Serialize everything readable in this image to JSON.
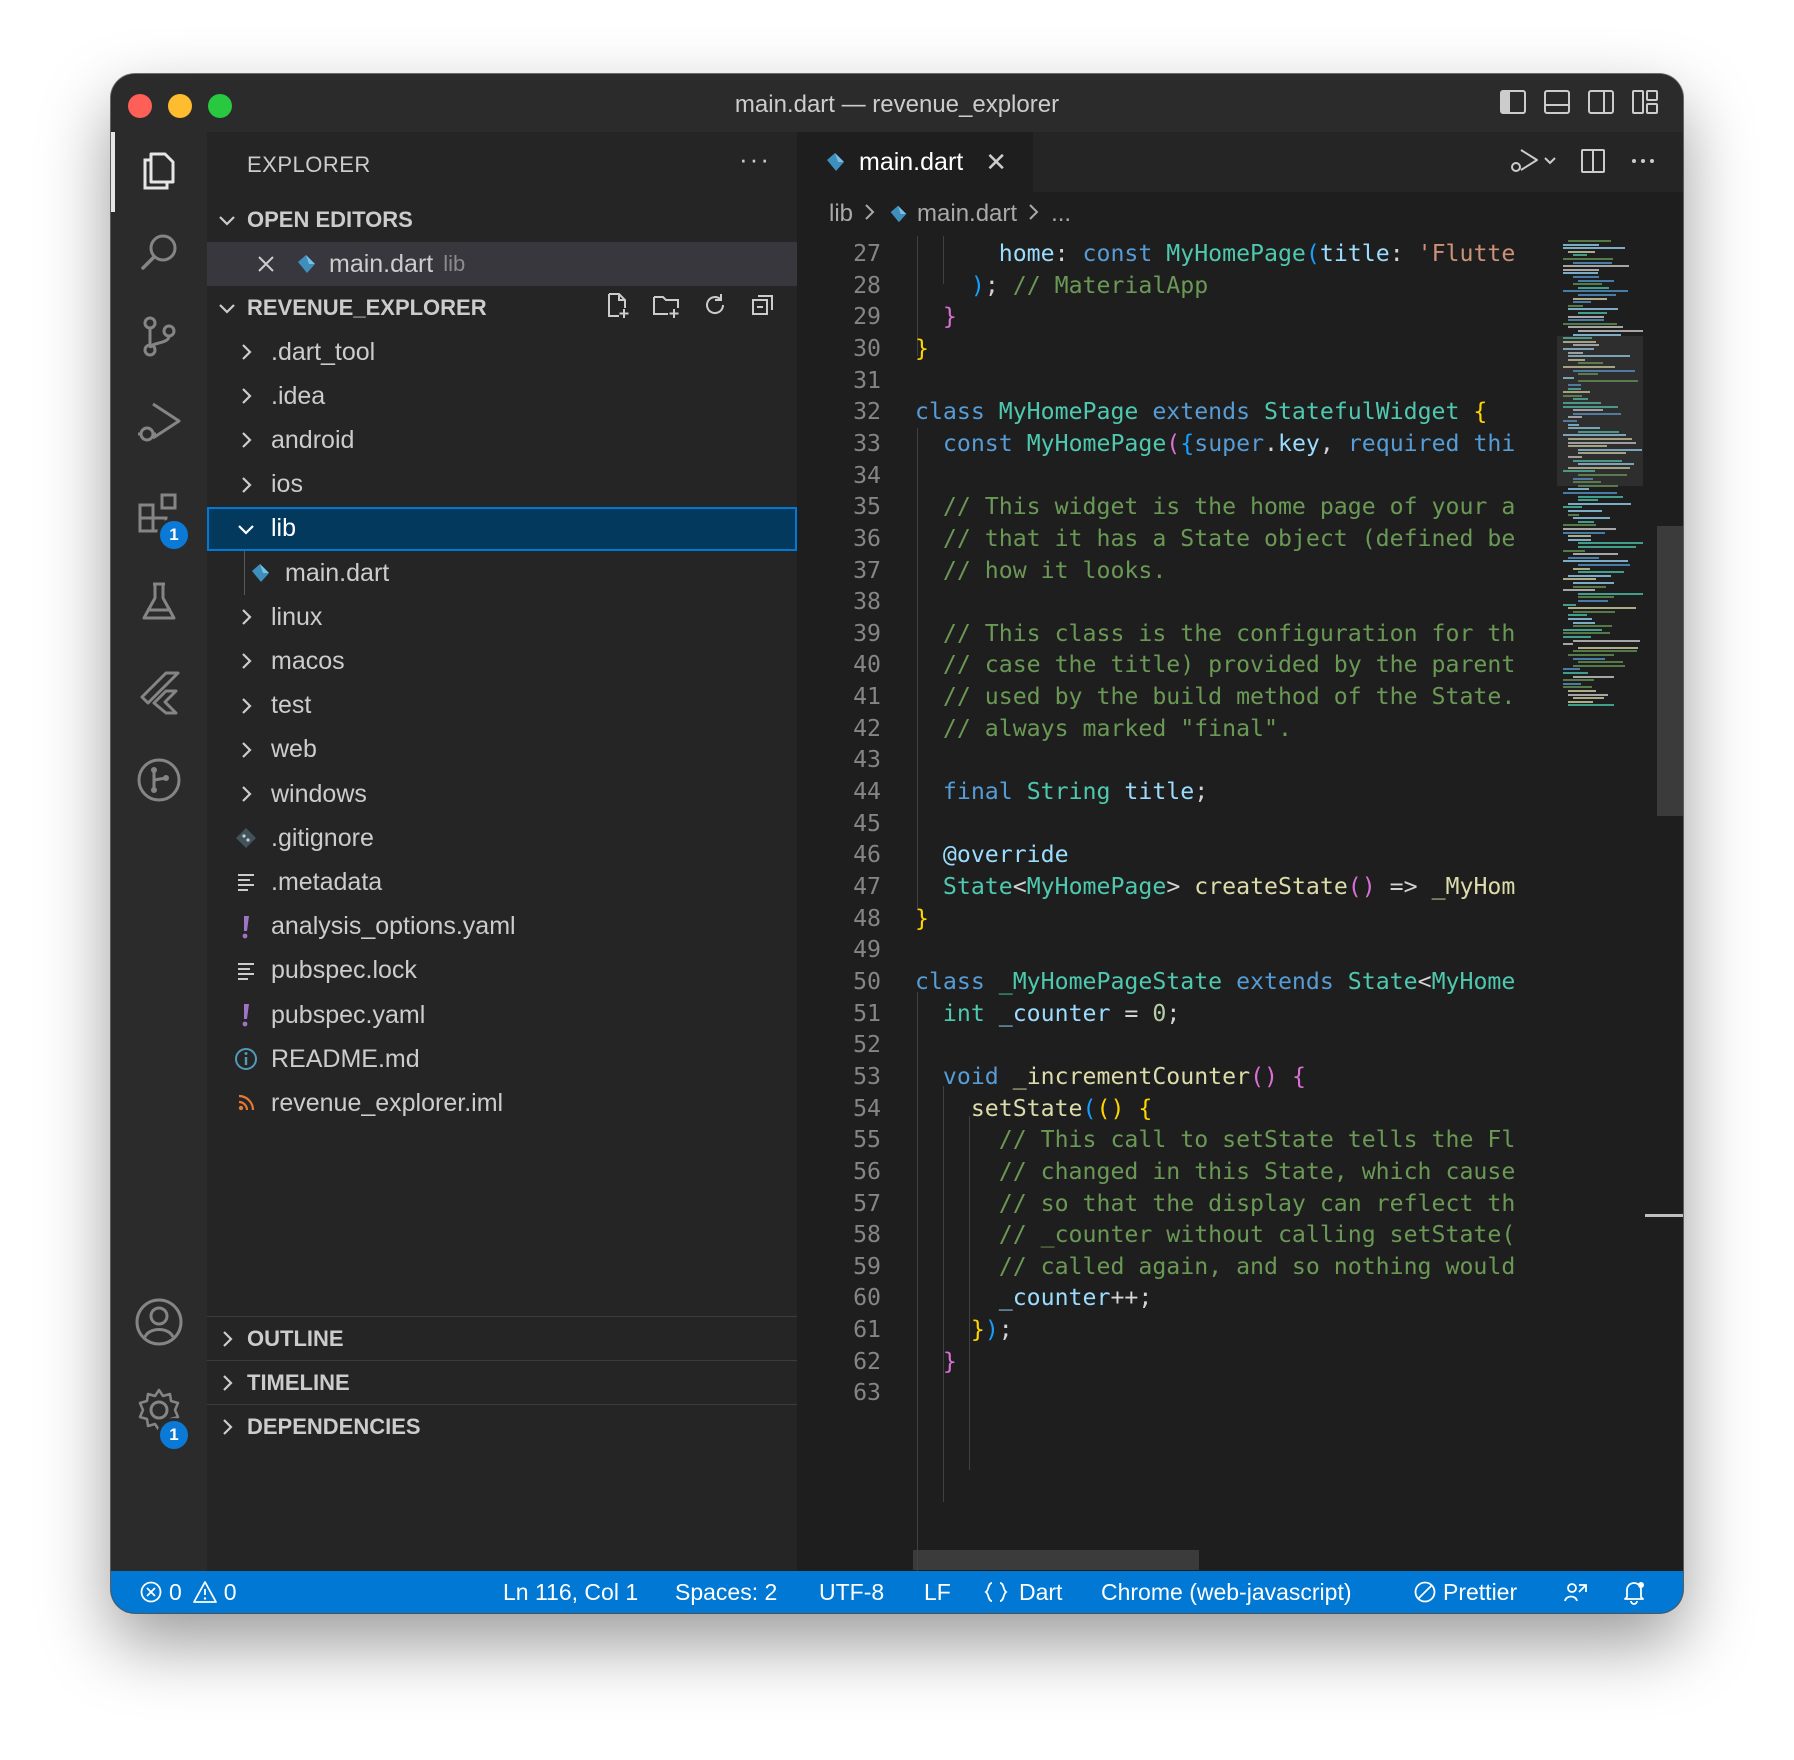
{
  "window": {
    "title": "main.dart — revenue_explorer"
  },
  "activity_bar": {
    "extensions_badge": "1",
    "settings_badge": "1"
  },
  "sidebar": {
    "header": "EXPLORER",
    "more": "···",
    "open_editors": {
      "title": "OPEN EDITORS",
      "items": [
        {
          "name": "main.dart",
          "folder": "lib"
        }
      ]
    },
    "project": {
      "title": "REVENUE_EXPLORER",
      "items": [
        {
          "name": ".dart_tool",
          "kind": "folder"
        },
        {
          "name": ".idea",
          "kind": "folder"
        },
        {
          "name": "android",
          "kind": "folder"
        },
        {
          "name": "ios",
          "kind": "folder"
        },
        {
          "name": "lib",
          "kind": "folder-open"
        },
        {
          "name": "main.dart",
          "kind": "dart-file"
        },
        {
          "name": "linux",
          "kind": "folder"
        },
        {
          "name": "macos",
          "kind": "folder"
        },
        {
          "name": "test",
          "kind": "folder"
        },
        {
          "name": "web",
          "kind": "folder"
        },
        {
          "name": "windows",
          "kind": "folder"
        },
        {
          "name": ".gitignore",
          "kind": "git-file"
        },
        {
          "name": ".metadata",
          "kind": "text-file"
        },
        {
          "name": "analysis_options.yaml",
          "kind": "yaml-file"
        },
        {
          "name": "pubspec.lock",
          "kind": "text-file"
        },
        {
          "name": "pubspec.yaml",
          "kind": "yaml-file"
        },
        {
          "name": "README.md",
          "kind": "info-file"
        },
        {
          "name": "revenue_explorer.iml",
          "kind": "rss-file"
        }
      ]
    },
    "bottom_sections": [
      "OUTLINE",
      "TIMELINE",
      "DEPENDENCIES"
    ]
  },
  "editor": {
    "tab": {
      "label": "main.dart",
      "close": "✕"
    },
    "breadcrumbs": {
      "folder": "lib",
      "file": "main.dart",
      "more": "..."
    },
    "lines": [
      {
        "n": "27",
        "segs": [
          [
            "vr",
            "      home"
          ],
          [
            "p",
            ": "
          ],
          [
            "kw",
            "const "
          ],
          [
            "ty",
            "MyHomePage"
          ],
          [
            "b3",
            "("
          ],
          [
            "vr",
            "title"
          ],
          [
            "p",
            ": "
          ],
          [
            "st",
            "'Flutte"
          ]
        ]
      },
      {
        "n": "28",
        "segs": [
          [
            "b3",
            "    )"
          ],
          [
            "p",
            "; "
          ],
          [
            "cm",
            "// MaterialApp"
          ]
        ]
      },
      {
        "n": "29",
        "segs": [
          [
            "b2",
            "  }"
          ]
        ]
      },
      {
        "n": "30",
        "segs": [
          [
            "b1",
            "}"
          ]
        ]
      },
      {
        "n": "31",
        "segs": []
      },
      {
        "n": "32",
        "segs": [
          [
            "kw",
            "class "
          ],
          [
            "ty",
            "MyHomePage "
          ],
          [
            "kw",
            "extends "
          ],
          [
            "ty",
            "StatefulWidget "
          ],
          [
            "b1",
            "{"
          ]
        ]
      },
      {
        "n": "33",
        "segs": [
          [
            "kw",
            "  const "
          ],
          [
            "ty",
            "MyHomePage"
          ],
          [
            "b2",
            "("
          ],
          [
            "b3",
            "{"
          ],
          [
            "kw",
            "super"
          ],
          [
            "p",
            "."
          ],
          [
            "vr",
            "key"
          ],
          [
            "p",
            ", "
          ],
          [
            "kw",
            "required "
          ],
          [
            "kw",
            "thi"
          ]
        ]
      },
      {
        "n": "34",
        "segs": []
      },
      {
        "n": "35",
        "segs": [
          [
            "cm",
            "  // This widget is the home page of your a"
          ]
        ]
      },
      {
        "n": "36",
        "segs": [
          [
            "cm",
            "  // that it has a State object (defined be"
          ]
        ]
      },
      {
        "n": "37",
        "segs": [
          [
            "cm",
            "  // how it looks."
          ]
        ]
      },
      {
        "n": "38",
        "segs": []
      },
      {
        "n": "39",
        "segs": [
          [
            "cm",
            "  // This class is the configuration for th"
          ]
        ]
      },
      {
        "n": "40",
        "segs": [
          [
            "cm",
            "  // case the title) provided by the parent"
          ]
        ]
      },
      {
        "n": "41",
        "segs": [
          [
            "cm",
            "  // used by the build method of the State."
          ]
        ]
      },
      {
        "n": "42",
        "segs": [
          [
            "cm",
            "  // always marked \"final\"."
          ]
        ]
      },
      {
        "n": "43",
        "segs": []
      },
      {
        "n": "44",
        "segs": [
          [
            "kw",
            "  final "
          ],
          [
            "ty",
            "String "
          ],
          [
            "vr",
            "title"
          ],
          [
            "p",
            ";"
          ]
        ]
      },
      {
        "n": "45",
        "segs": []
      },
      {
        "n": "46",
        "segs": [
          [
            "vr",
            "  @override"
          ]
        ]
      },
      {
        "n": "47",
        "segs": [
          [
            "ty",
            "  State"
          ],
          [
            "p",
            "<"
          ],
          [
            "ty",
            "MyHomePage"
          ],
          [
            "p",
            "> "
          ],
          [
            "fn",
            "createState"
          ],
          [
            "b2",
            "()"
          ],
          [
            "p",
            " => "
          ],
          [
            "fn",
            "_MyHom"
          ]
        ]
      },
      {
        "n": "48",
        "segs": [
          [
            "b1",
            "}"
          ]
        ]
      },
      {
        "n": "49",
        "segs": []
      },
      {
        "n": "50",
        "segs": [
          [
            "kw",
            "class "
          ],
          [
            "ty",
            "_MyHomePageState "
          ],
          [
            "kw",
            "extends "
          ],
          [
            "ty",
            "State"
          ],
          [
            "p",
            "<"
          ],
          [
            "ty",
            "MyHome"
          ]
        ]
      },
      {
        "n": "51",
        "segs": [
          [
            "ty",
            "  int "
          ],
          [
            "vr",
            "_counter"
          ],
          [
            "p",
            " = "
          ],
          [
            "nm",
            "0"
          ],
          [
            "p",
            ";"
          ]
        ]
      },
      {
        "n": "52",
        "segs": []
      },
      {
        "n": "53",
        "segs": [
          [
            "kw",
            "  void "
          ],
          [
            "fn",
            "_incrementCounter"
          ],
          [
            "b2",
            "() {"
          ]
        ]
      },
      {
        "n": "54",
        "segs": [
          [
            "fn",
            "    setState"
          ],
          [
            "b3",
            "("
          ],
          [
            "b1",
            "() {"
          ]
        ]
      },
      {
        "n": "55",
        "segs": [
          [
            "cm",
            "      // This call to setState tells the Fl"
          ]
        ]
      },
      {
        "n": "56",
        "segs": [
          [
            "cm",
            "      // changed in this State, which cause"
          ]
        ]
      },
      {
        "n": "57",
        "segs": [
          [
            "cm",
            "      // so that the display can reflect th"
          ]
        ]
      },
      {
        "n": "58",
        "segs": [
          [
            "cm",
            "      // _counter without calling setState("
          ]
        ]
      },
      {
        "n": "59",
        "segs": [
          [
            "cm",
            "      // called again, and so nothing would"
          ]
        ]
      },
      {
        "n": "60",
        "segs": [
          [
            "vr",
            "      _counter"
          ],
          [
            "p",
            "++;"
          ]
        ]
      },
      {
        "n": "61",
        "segs": [
          [
            "b1",
            "    }"
          ],
          [
            "b3",
            ")"
          ],
          [
            "p",
            ";"
          ]
        ]
      },
      {
        "n": "62",
        "segs": [
          [
            "b2",
            "  }"
          ]
        ]
      },
      {
        "n": "63",
        "segs": []
      }
    ]
  },
  "status_bar": {
    "errors": "0",
    "warnings": "0",
    "position": "Ln 116, Col 1",
    "spaces": "Spaces: 2",
    "encoding": "UTF-8",
    "eol": "LF",
    "language": "Dart",
    "device": "Chrome (web-javascript)",
    "formatter": "Prettier"
  },
  "colors": {
    "accent": "#0078d4",
    "selection": "#04395e",
    "keyword": "#569cd6",
    "type": "#4ec9b0",
    "function": "#dcdcaa",
    "comment": "#6a9955",
    "string": "#ce9178"
  }
}
